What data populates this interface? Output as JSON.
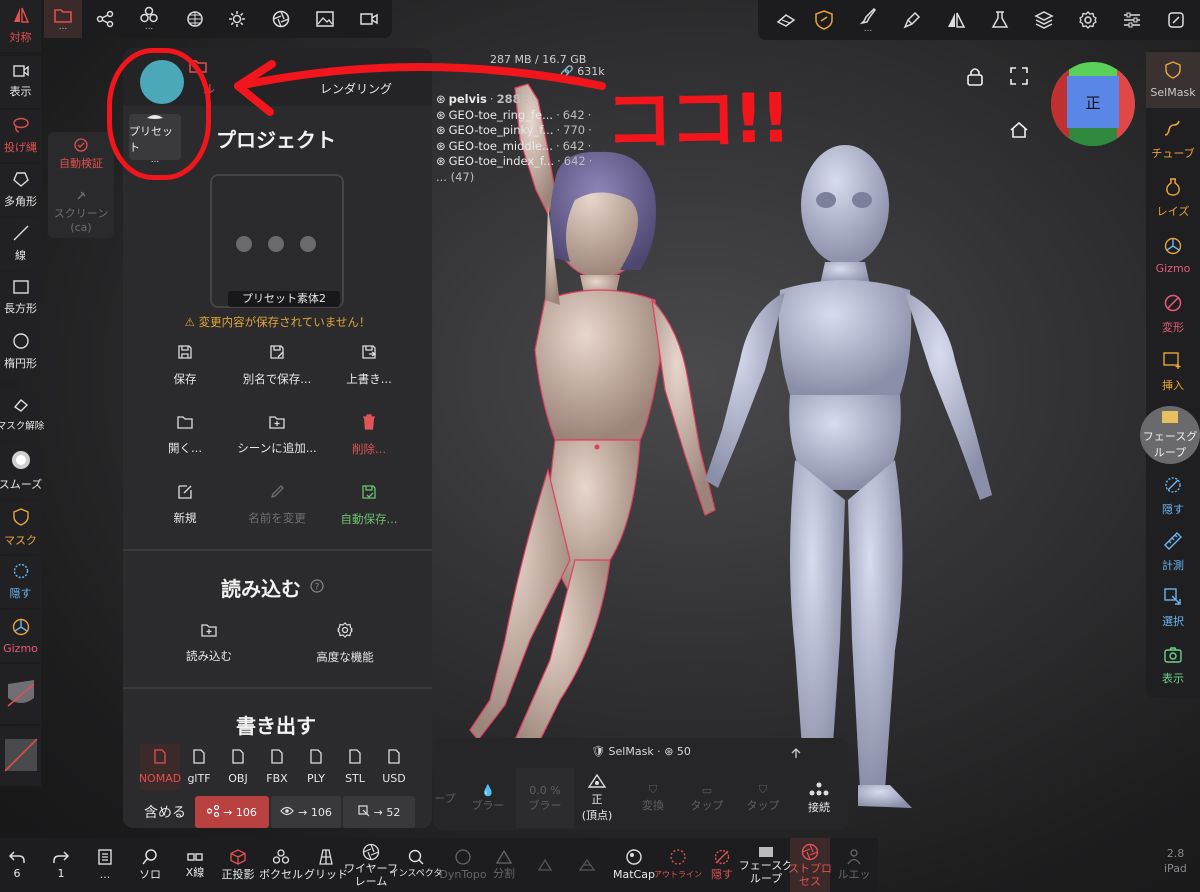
{
  "top_left_bar": {
    "items": [
      {
        "icon": "logo-icon",
        "sub": ""
      },
      {
        "icon": "folder-icon",
        "sub": "..."
      },
      {
        "icon": "scene-graph-icon",
        "sub": ""
      },
      {
        "icon": "layers-icon",
        "sub": "..."
      },
      {
        "icon": "material-icon",
        "sub": ""
      },
      {
        "icon": "sun-icon",
        "sub": ""
      },
      {
        "icon": "aperture-icon",
        "sub": ""
      },
      {
        "icon": "image-icon",
        "sub": ""
      },
      {
        "icon": "camera-icon",
        "sub": ""
      }
    ]
  },
  "top_right_bar": {
    "items": [
      {
        "icon": "eraser-tool-icon"
      },
      {
        "icon": "mask-shield-icon"
      },
      {
        "icon": "brush-icon"
      },
      {
        "icon": "paint-icon"
      },
      {
        "icon": "symmetry-icon"
      },
      {
        "icon": "flask-icon"
      },
      {
        "icon": "stack-icon"
      },
      {
        "icon": "gear-icon"
      },
      {
        "icon": "sliders-icon"
      },
      {
        "icon": "screenshot-icon"
      }
    ]
  },
  "left_tools": {
    "symmetry": "対称",
    "display": "表示",
    "lasso": "投げ縄",
    "polygon": "多角形",
    "line": "線",
    "rectangle": "長方形",
    "ellipse": "楕円形",
    "unmask": "マスク解除",
    "smooth": "スムーズ",
    "mask": "マスク",
    "hide": "隠す",
    "gizmo": "Gizmo"
  },
  "auto_panel": {
    "auto_detect": "自動検証",
    "screen": "スクリーン",
    "screen_sub": "(ca)"
  },
  "file_panel": {
    "header_folder_label": "ル",
    "header_render_label": "レンダリング",
    "preset_label": "プリセット",
    "preset_sub": "...",
    "project_title": "プロジェクト",
    "preview_caption": "プリセット素体2",
    "unsaved_warning": "⚠ 変更内容が保存されていません！",
    "actions": [
      {
        "label": "保存",
        "icon": "save-icon"
      },
      {
        "label": "別名で保存...",
        "icon": "save-as-icon"
      },
      {
        "label": "上書き...",
        "icon": "overwrite-icon"
      },
      {
        "label": "開く...",
        "icon": "open-folder-icon"
      },
      {
        "label": "シーンに追加...",
        "icon": "add-to-scene-icon"
      },
      {
        "label": "削除...",
        "icon": "trash-icon"
      },
      {
        "label": "新規",
        "icon": "new-file-icon"
      },
      {
        "label": "名前を変更",
        "icon": "rename-icon"
      },
      {
        "label": "自動保存...",
        "icon": "autosave-icon"
      }
    ],
    "import_title": "読み込む",
    "import_actions": [
      {
        "label": "読み込む",
        "icon": "import-icon"
      },
      {
        "label": "高度な機能",
        "icon": "advanced-gear-icon"
      }
    ],
    "export_title": "書き出す",
    "formats": [
      "NOMAD",
      "glTF",
      "OBJ",
      "FBX",
      "PLY",
      "STL",
      "USD"
    ],
    "include_label": "含める",
    "include_buttons": [
      {
        "label": "→ 106",
        "icon": "graph-icon"
      },
      {
        "label": "→ 106",
        "icon": "eye-icon"
      },
      {
        "label": "→ 52",
        "icon": "select-icon"
      }
    ]
  },
  "scene_info": {
    "memory": "287 MB / 16.7 GB",
    "triangles": "631k",
    "rows": [
      {
        "name": "pelvis",
        "count": "2882",
        "bold": true
      },
      {
        "name": "GEO-toe_ring_fe...",
        "count": "642"
      },
      {
        "name": "GEO-toe_pinky_f...",
        "count": "770"
      },
      {
        "name": "GEO-toe_middle...",
        "count": "642"
      },
      {
        "name": "GEO-toe_index_f...",
        "count": "642"
      }
    ],
    "more": "... (47)"
  },
  "viewport": {
    "view_cube_label": "正"
  },
  "right_tools": {
    "selmask": "SelMask",
    "tube": "チューブ",
    "layer": "レイズ",
    "gizmo": "Gizmo",
    "transform": "変形",
    "insert": "挿入",
    "facegroup": "フェースグ",
    "facegroup_sub": "ループ",
    "hide": "隠す",
    "measure": "計測",
    "select": "選択",
    "view": "表示"
  },
  "selmask_bar": {
    "title": "SelMask · ",
    "count": "50",
    "dim_labels": [
      "ープ",
      "ブラー",
      "ブラー",
      "変換",
      "タップ",
      "タップ"
    ],
    "dim_values": [
      "0.0 %"
    ],
    "front_label": "正",
    "front_sub": "(頂点)",
    "connect": "接続"
  },
  "bottom_bar": {
    "undo": "6",
    "redo": "1",
    "page": "...",
    "solo": "ソロ",
    "xray": "X線",
    "ortho": "正投影",
    "voxel": "ボクセル",
    "grid": "グリッド",
    "wireframe": "ワイヤーフ",
    "wireframe_sub": "レーム",
    "inspector": "インスペクタ",
    "dyntopo": "DynTopo",
    "split": "分割",
    "matcap": "MatCap",
    "outline": "アウトライン",
    "hide": "隠す",
    "facegroup": "フェースグ",
    "facegroup_sub": "ループ",
    "postprocess": "ストプロ",
    "postprocess_sub": "セス",
    "silhouette": "ルエッ"
  },
  "annotation": {
    "text": "ココ!!"
  },
  "version": {
    "number": "2.8",
    "device": "iPad"
  },
  "colors": {
    "accent_red": "#e05050",
    "accent_orange": "#e8a43a",
    "annotation_red": "#f3151c"
  }
}
